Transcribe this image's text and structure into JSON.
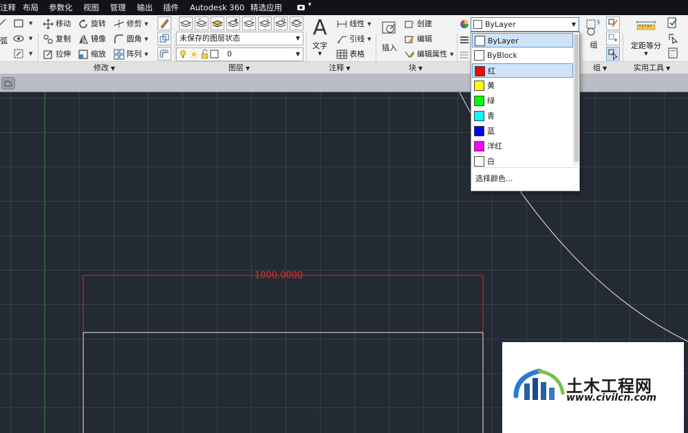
{
  "menubar": {
    "items": [
      "注释",
      "布局",
      "参数化",
      "视图",
      "管理",
      "输出",
      "插件",
      "Autodesk 360",
      "精选应用"
    ],
    "camera_dropdown": "▾"
  },
  "ribbon": {
    "modify": {
      "title": "修改",
      "move": "移动",
      "rotate": "旋转",
      "trim": "修剪",
      "copy": "复制",
      "mirror": "镜像",
      "fillet": "圆角",
      "stretch": "拉伸",
      "scale": "缩放",
      "array": "阵列",
      "arc_partial": "弧"
    },
    "layers": {
      "title": "图层",
      "layer_state": "未保存的图层状态",
      "current_layer": "0"
    },
    "annotation": {
      "title": "注释",
      "text": "文字",
      "linear": "线性",
      "leader": "引线",
      "table": "表格"
    },
    "block": {
      "title": "块",
      "insert": "插入",
      "create": "创建",
      "edit": "编辑",
      "edit_attributes": "编辑属性"
    },
    "group": {
      "title": "组",
      "label": "组"
    },
    "utilities": {
      "title": "实用工具",
      "measure": "定距等分"
    }
  },
  "color_dropdown": {
    "current": "ByLayer",
    "options": [
      {
        "label": "ByLayer",
        "color": "#ffffff",
        "state": "selected"
      },
      {
        "label": "ByBlock",
        "color": "#ffffff",
        "state": "normal"
      },
      {
        "label": "红",
        "color": "#ff0000",
        "state": "hover"
      },
      {
        "label": "黄",
        "color": "#ffff00",
        "state": "normal"
      },
      {
        "label": "绿",
        "color": "#00ff00",
        "state": "normal"
      },
      {
        "label": "青",
        "color": "#00ffff",
        "state": "normal"
      },
      {
        "label": "蓝",
        "color": "#0000ff",
        "state": "normal"
      },
      {
        "label": "洋红",
        "color": "#ff00ff",
        "state": "normal"
      },
      {
        "label": "白",
        "color": "#ffffff",
        "state": "normal"
      }
    ],
    "choose_color": "选择颜色..."
  },
  "drawing": {
    "dimension_text": "1000.0000",
    "dimension_color": "#ee2a2a",
    "line_color": "#e8e8e8",
    "background": "#242a34"
  },
  "watermark": {
    "title": "土木工程网",
    "url": "www.civilcn.com"
  }
}
